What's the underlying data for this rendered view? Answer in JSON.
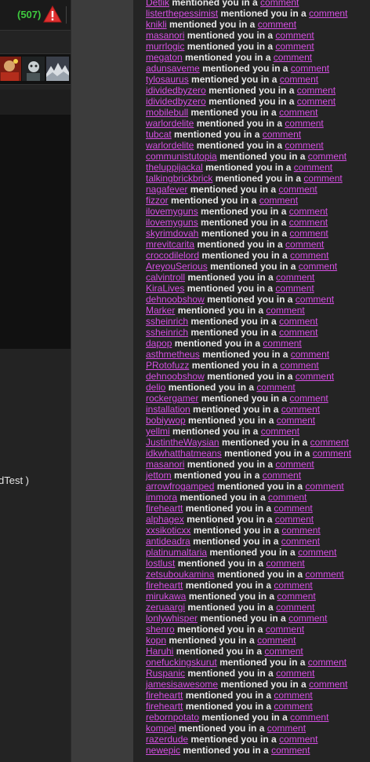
{
  "header": {
    "notification_count": "(507)",
    "alert_icon": "warning-triangle-icon"
  },
  "thumbnails": [
    "thumb-1",
    "thumb-2",
    "thumb-3"
  ],
  "sidebar_cut_text": "dTest )",
  "notifications": {
    "middle_text": "mentioned you in a",
    "link_text": "comment",
    "users": [
      "Detlik",
      "listerthepessimist",
      "knikli",
      "masanori",
      "murrlogic",
      "megaton",
      "adunsaveme",
      "tylosaurus",
      "idividedbyzero",
      "idividedbyzero",
      "mobilebull",
      "warlordelite",
      "tubcat",
      "warlordelite",
      "communistutopia",
      "theluppijackal",
      "talkingbrickbrick",
      "nagafever",
      "fizzor",
      "ilovemyguns",
      "ilovemyguns",
      "skyrimdovah",
      "mrevitcarita",
      "crocodilelord",
      "AreyouSerious",
      "calvintroll",
      "KiraLives",
      "dehnoobshow",
      "Marker",
      "ssheinrich",
      "ssheinrich",
      "dapop",
      "asthmetheus",
      "PRotofuzz",
      "dehnoobshow",
      "delio",
      "rockergamer",
      "installation",
      "bobiywop",
      "yellmi",
      "JustintheWaysian",
      "idkwhatthatmeans",
      "masanori",
      "jettom",
      "arrowfrogamped",
      "immora",
      "fireheartt",
      "alphagex",
      "xxsikoticxx",
      "antideadra",
      "platinumaltaria",
      "lostlust",
      "zetsuboukamina",
      "fireheartt",
      "mirukawa",
      "zeruaargi",
      "lonlywhisper",
      "shenro",
      "kopn",
      "Haruhi",
      "onefuckingskurut",
      "Ruspanic",
      "jamesisawesome",
      "fireheartt",
      "fireheartt",
      "rebornpotato",
      "kompel",
      "razerdude",
      "newepic"
    ]
  }
}
